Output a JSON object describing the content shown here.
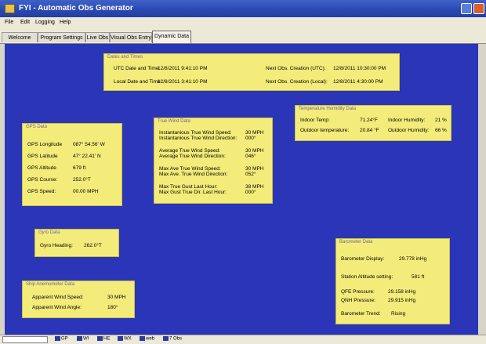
{
  "window": {
    "title": "FYI - Automatic Obs Generator"
  },
  "menu": [
    "File",
    "Edit",
    "Logging",
    "Help"
  ],
  "tabs": [
    "Welcome",
    "Program Settings",
    "Live Obs",
    "Visual Obs Entry",
    "Dynamic Data"
  ],
  "dates": {
    "title": "Dates and Times",
    "utc_label": "UTC Date and Time:",
    "utc_value": "12/8/2011 9:41:10 PM",
    "local_label": "Local Date and Time:",
    "local_value": "12/8/2011 3:41:10 PM",
    "next_utc_label": "Next Obs. Creation (UTC):",
    "next_utc_value": "12/8/2011 10:30:00 PM",
    "next_local_label": "Next Obs. Creation (Local):",
    "next_local_value": "12/8/2011 4:30:00 PM"
  },
  "gps": {
    "title": "GPS Data",
    "rows": [
      {
        "label": "GPS Longitude",
        "value": "087° 54.56' W"
      },
      {
        "label": "GPS Latitude",
        "value": "47° 22.41' N"
      },
      {
        "label": "GPS Altitude",
        "value": "679 ft"
      },
      {
        "label": "GPS Course:",
        "value": "252.0°T"
      },
      {
        "label": "GPS Speed:",
        "value": "00.00 MPH"
      }
    ]
  },
  "wind": {
    "title": "True Wind Data",
    "groups": [
      {
        "l1": "Instantanious True Wind Speed:",
        "l2": "Instantanious True Wind Direction:",
        "v1": "30 MPH",
        "v2": "000°"
      },
      {
        "l1": "Average True Wind Speed:",
        "l2": "Average True Wind Direction:",
        "v1": "30 MPH",
        "v2": "046°"
      },
      {
        "l1": "Max Ave True Wind Speed:",
        "l2": "Max Ave. True Wind Direction:",
        "v1": "30 MPH",
        "v2": "052°"
      },
      {
        "l1": "Max True Gust Last Hour:",
        "l2": "Max Gust True Dir. Last Hour:",
        "v1": "38 MPH",
        "v2": "000°"
      }
    ]
  },
  "temp": {
    "title": "Temperature Humidity Data",
    "indoor_temp_label": "Indoor Temp:",
    "indoor_temp_value": "71.24°F",
    "indoor_hum_label": "Indoor Humidity:",
    "indoor_hum_value": "21 %",
    "outdoor_temp_label": "Outdoor temperature:",
    "outdoor_temp_value": "20.84 °F",
    "outdoor_hum_label": "Outdoor Humidity:",
    "outdoor_hum_value": "66 %"
  },
  "gyro": {
    "title": "Gyro Data",
    "label": "Gyro Heading:",
    "value": "262.0°T"
  },
  "anemo": {
    "title": "Ship Anemometer Data",
    "speed_label": "Apparent Wind Speed:",
    "speed_value": "30 MPH",
    "angle_label": "Apparent Wind Angle:",
    "angle_value": "180°"
  },
  "baro": {
    "title": "Barometer Data",
    "display_label": "Barometer Display:",
    "display_value": "29.778 inHg",
    "station_label": "Station Altitude setting:",
    "station_value": "581 ft",
    "qfe_label": "QFE Pressure:",
    "qfe_value": "29.158 inHg",
    "qnh_label": "QNH Pressure:",
    "qnh_value": "29.915 inHg",
    "trend_label": "Barometer Trend:",
    "trend_value": "Rising"
  },
  "status": {
    "indicators": [
      "GP",
      "WI",
      "HE",
      "WX",
      "web",
      "7 Obs"
    ]
  },
  "colors": {
    "background": "#2a35b8",
    "panel": "#f4ec7a",
    "titlebar": "#2a47b0"
  }
}
